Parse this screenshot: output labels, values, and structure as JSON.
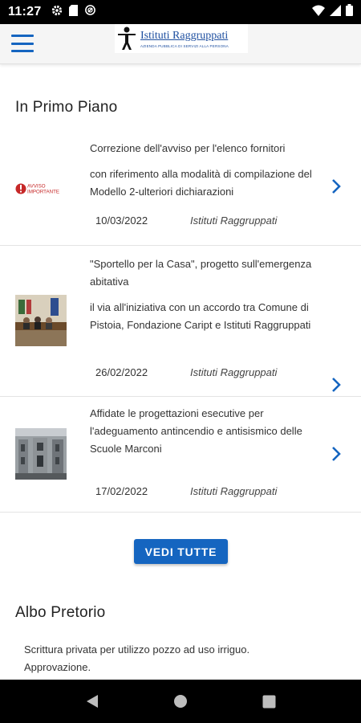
{
  "status_bar": {
    "time": "11:27",
    "left_icons": [
      "gear-icon",
      "sd-card-icon",
      "no-disturb-icon"
    ],
    "right_icons": [
      "wifi-icon",
      "signal-icon",
      "battery-icon"
    ]
  },
  "app_bar": {
    "logo_name": "Istituti Raggruppati",
    "logo_subtitle": "AZIENDA PUBBLICA DI SERVIZI ALLA PERSONA"
  },
  "primo_piano": {
    "title": "In Primo Piano",
    "items": [
      {
        "thumb": "avviso-importante-icon",
        "thumb_label": "AVVISO IMPORTANTE",
        "heading": "Correzione dell'avviso per l'elenco fornitori",
        "body": "con riferimento alla modalità di compilazione del Modello 2-ulteriori dichiarazioni",
        "date": "10/03/2022",
        "source": "Istituti Raggruppati"
      },
      {
        "thumb": "conference-photo",
        "heading": "\"Sportello per la Casa\", progetto sull'emergenza abitativa",
        "body": "il via all'iniziativa con un accordo tra Comune di Pistoia, Fondazione Caript e Istituti Raggruppati",
        "date": "26/02/2022",
        "source": "Istituti Raggruppati"
      },
      {
        "thumb": "school-building-photo",
        "heading": "Affidate le progettazioni esecutive per l'adeguamento antincendio e antisismico delle Scuole Marconi",
        "body": "",
        "date": "17/02/2022",
        "source": "Istituti Raggruppati"
      }
    ],
    "button_label": "VEDI TUTTE"
  },
  "albo_pretorio": {
    "title": "Albo Pretorio",
    "first_item": "Scrittura privata per utilizzo pozzo ad uso irriguo. Approvazione."
  },
  "colors": {
    "accent": "#1565c0",
    "avviso_red": "#c62828"
  }
}
